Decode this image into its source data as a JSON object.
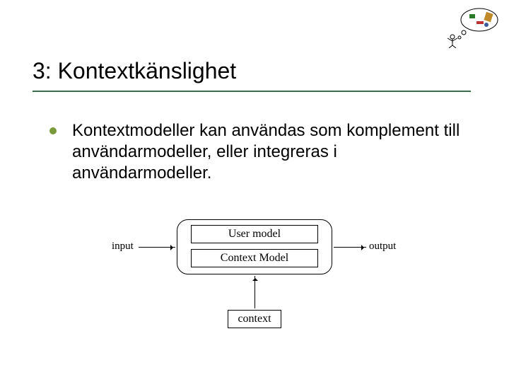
{
  "title": "3: Kontextkänslighet",
  "bullet": "Kontextmodeller kan användas som komplement till användarmodeller, eller integreras i användarmodeller.",
  "diagram": {
    "input_label": "input",
    "output_label": "output",
    "user_model_label": "User model",
    "context_model_label": "Context Model",
    "context_label": "context"
  }
}
